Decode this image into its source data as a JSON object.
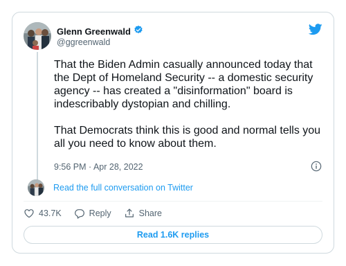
{
  "author": {
    "name": "Glenn Greenwald",
    "handle": "@ggreenwald",
    "verified": true
  },
  "tweet": {
    "paragraphs": [
      "That the Biden Admin casually announced today that the Dept of Homeland Security -- a domestic security agency -- has created a \"disinformation\" board is indescribably dystopian and chilling.",
      "That Democrats think this is good and normal tells you all you need to know about them."
    ],
    "timestamp": "9:56 PM · Apr 28, 2022"
  },
  "conversation_link": "Read the full conversation on Twitter",
  "actions": {
    "likes": "43.7K",
    "reply_label": "Reply",
    "share_label": "Share"
  },
  "read_replies": "Read 1.6K replies",
  "colors": {
    "accent": "#1d9bf0",
    "text": "#0f1419",
    "secondary": "#536471",
    "border": "#cfd9de"
  },
  "icons": [
    "verified-badge-icon",
    "twitter-bird-icon",
    "info-icon",
    "heart-icon",
    "reply-icon",
    "share-icon"
  ]
}
